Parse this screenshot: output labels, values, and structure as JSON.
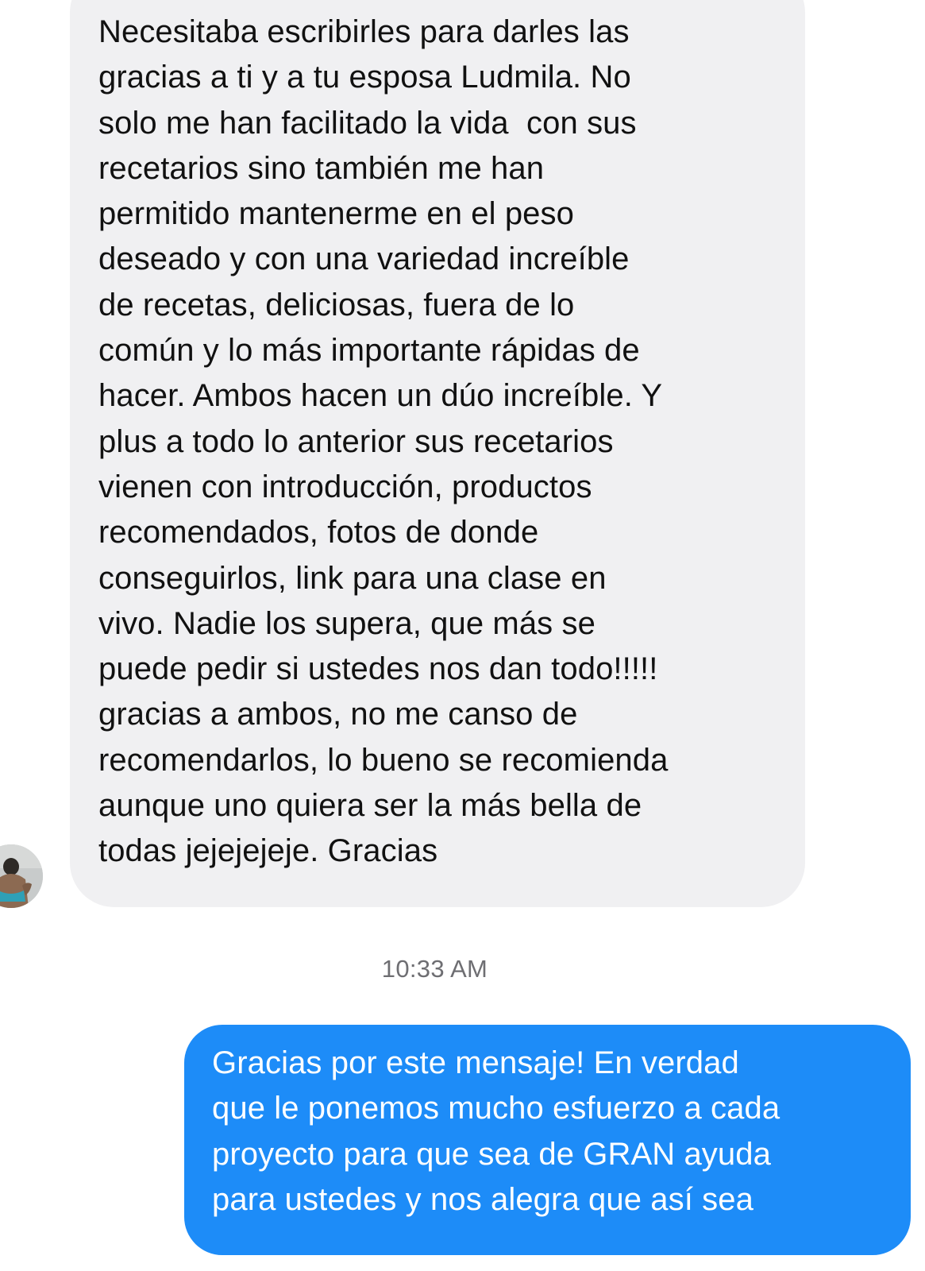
{
  "conversation": {
    "incoming_message": {
      "lines": [
        "Necesitaba escribirles para darles las",
        "gracias a ti y a tu esposa Ludmila. No",
        "solo me han facilitado la vida  con sus",
        "recetarios sino también me han",
        "permitido mantenerme en el peso",
        "deseado y con una variedad increíble",
        "de recetas, deliciosas, fuera de lo",
        "común y lo más importante rápidas de",
        "hacer. Ambos hacen un dúo increíble. Y",
        "plus a todo lo anterior sus recetarios",
        "vienen con introducción, productos",
        "recomendados, fotos de donde",
        "conseguirlos, link para una clase en",
        "vivo. Nadie los supera, que más se",
        "puede pedir si ustedes nos dan todo!!!!!",
        "gracias a ambos, no me canso de",
        "recomendarlos, lo bueno se recomienda",
        "aunque uno quiera ser la más bella de",
        "todas jejejejeje. Gracias"
      ],
      "bubble_color": "#f0f0f2",
      "text_color": "#111111"
    },
    "sender_avatar": {
      "icon": "user-avatar-photo"
    },
    "timestamp": "10:33 AM",
    "outgoing_message": {
      "lines": [
        "Gracias por este mensaje! En verdad",
        "que le ponemos mucho esfuerzo a cada",
        "proyecto para que sea de GRAN ayuda",
        "para ustedes y nos alegra que así sea"
      ],
      "bubble_color": "#1d8cf8",
      "text_color": "#ffffff"
    }
  }
}
